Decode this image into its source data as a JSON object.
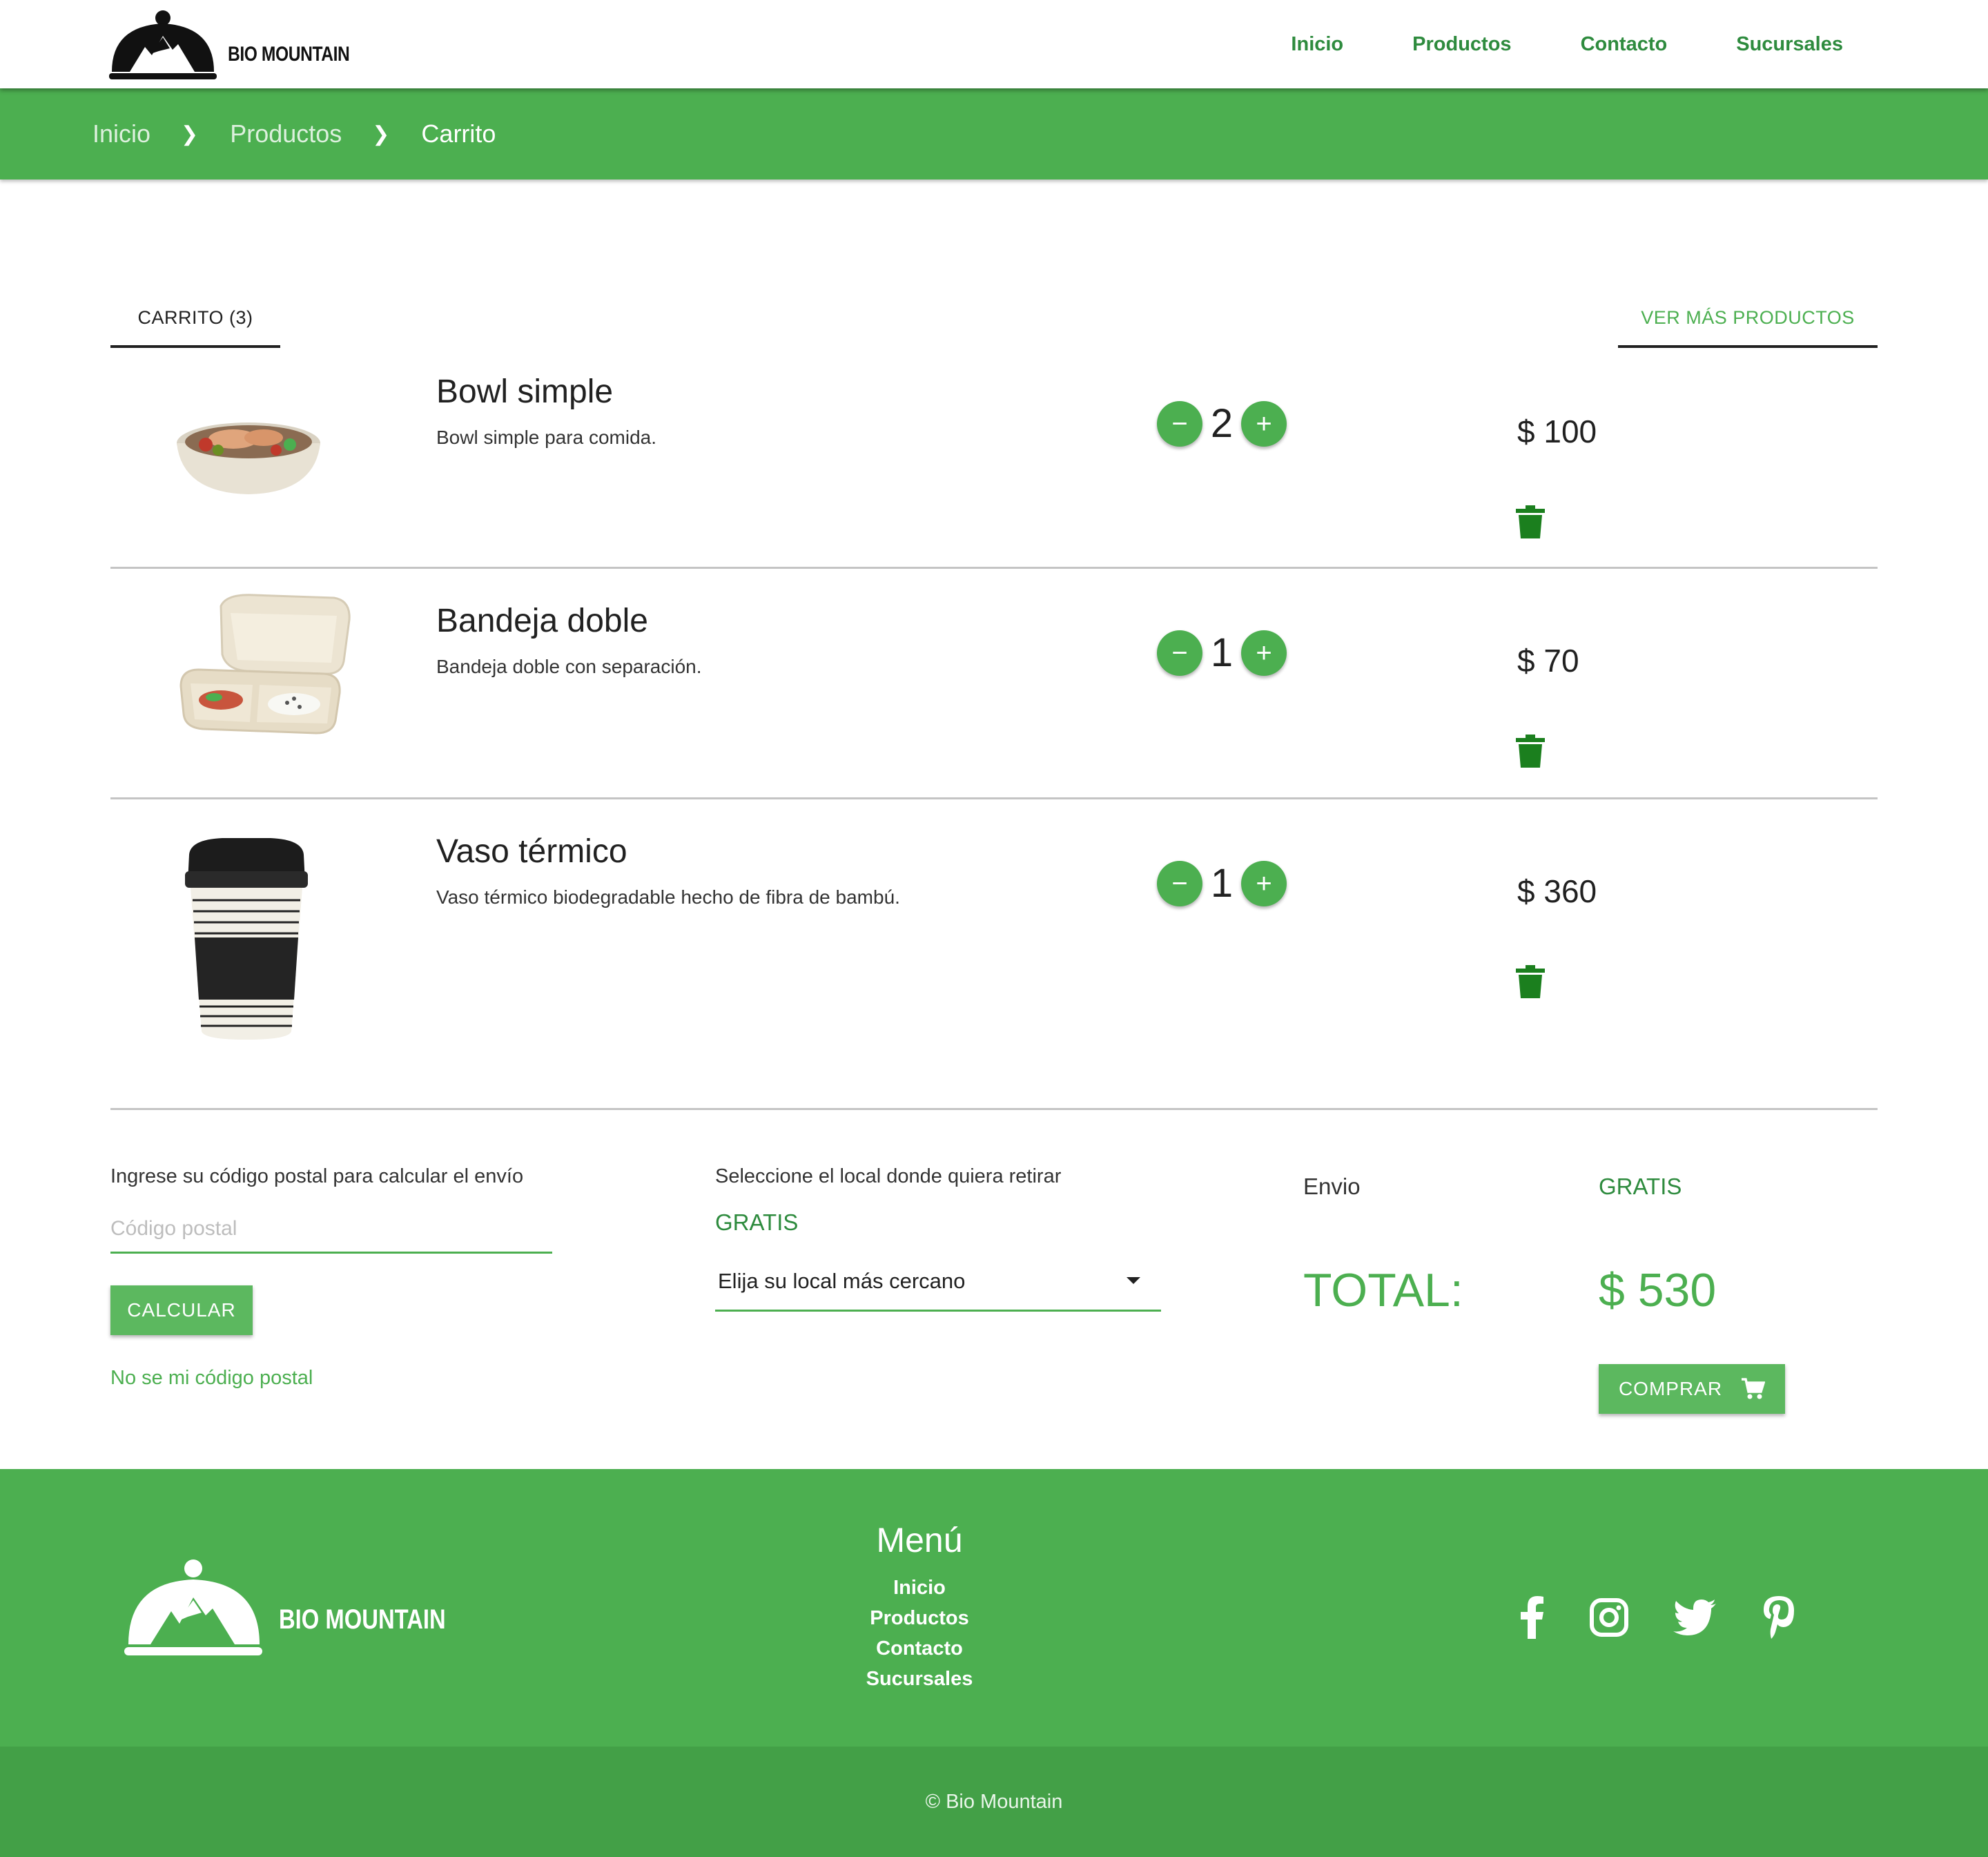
{
  "brand": {
    "name": "BIO MOUNTAIN"
  },
  "nav": {
    "items": [
      "Inicio",
      "Productos",
      "Contacto",
      "Sucursales"
    ]
  },
  "breadcrumb": [
    "Inicio",
    "Productos",
    "Carrito"
  ],
  "tabs": {
    "cart": "CARRITO (3)",
    "more": "VER MÁS PRODUCTOS"
  },
  "cart": {
    "items": [
      {
        "name": "Bowl simple",
        "description": "Bowl simple para comida.",
        "quantity": "2",
        "price": "$ 100"
      },
      {
        "name": "Bandeja doble",
        "description": "Bandeja doble con separación.",
        "quantity": "1",
        "price": "$ 70"
      },
      {
        "name": "Vaso térmico",
        "description": "Vaso térmico biodegradable hecho de fibra de bambú.",
        "quantity": "1",
        "price": "$ 360"
      }
    ],
    "minus": "−",
    "plus": "+"
  },
  "shipping": {
    "zip_label": "Ingrese su código postal para calcular el envío",
    "zip_placeholder": "Código postal",
    "calc_button": "CALCULAR",
    "zip_help": "No se mi código postal",
    "store_label": "Seleccione el local donde quiera retirar",
    "store_price": "GRATIS",
    "store_select": "Elija su local más cercano"
  },
  "summary": {
    "shipping_label": "Envio",
    "shipping_value": "GRATIS",
    "total_label": "TOTAL:",
    "total_value": "$ 530",
    "buy_button": "COMPRAR"
  },
  "footer": {
    "brand": "BIO MOUNTAIN",
    "menu_title": "Menú",
    "menu": [
      "Inicio",
      "Productos",
      "Contacto",
      "Sucursales"
    ],
    "social": [
      "facebook-icon",
      "instagram-icon",
      "twitter-icon",
      "pinterest-icon"
    ],
    "copyright": "© Bio Mountain"
  },
  "colors": {
    "primary": "#4caf50",
    "dark_green": "#2e8b3e",
    "trash": "#1b7f1e"
  }
}
